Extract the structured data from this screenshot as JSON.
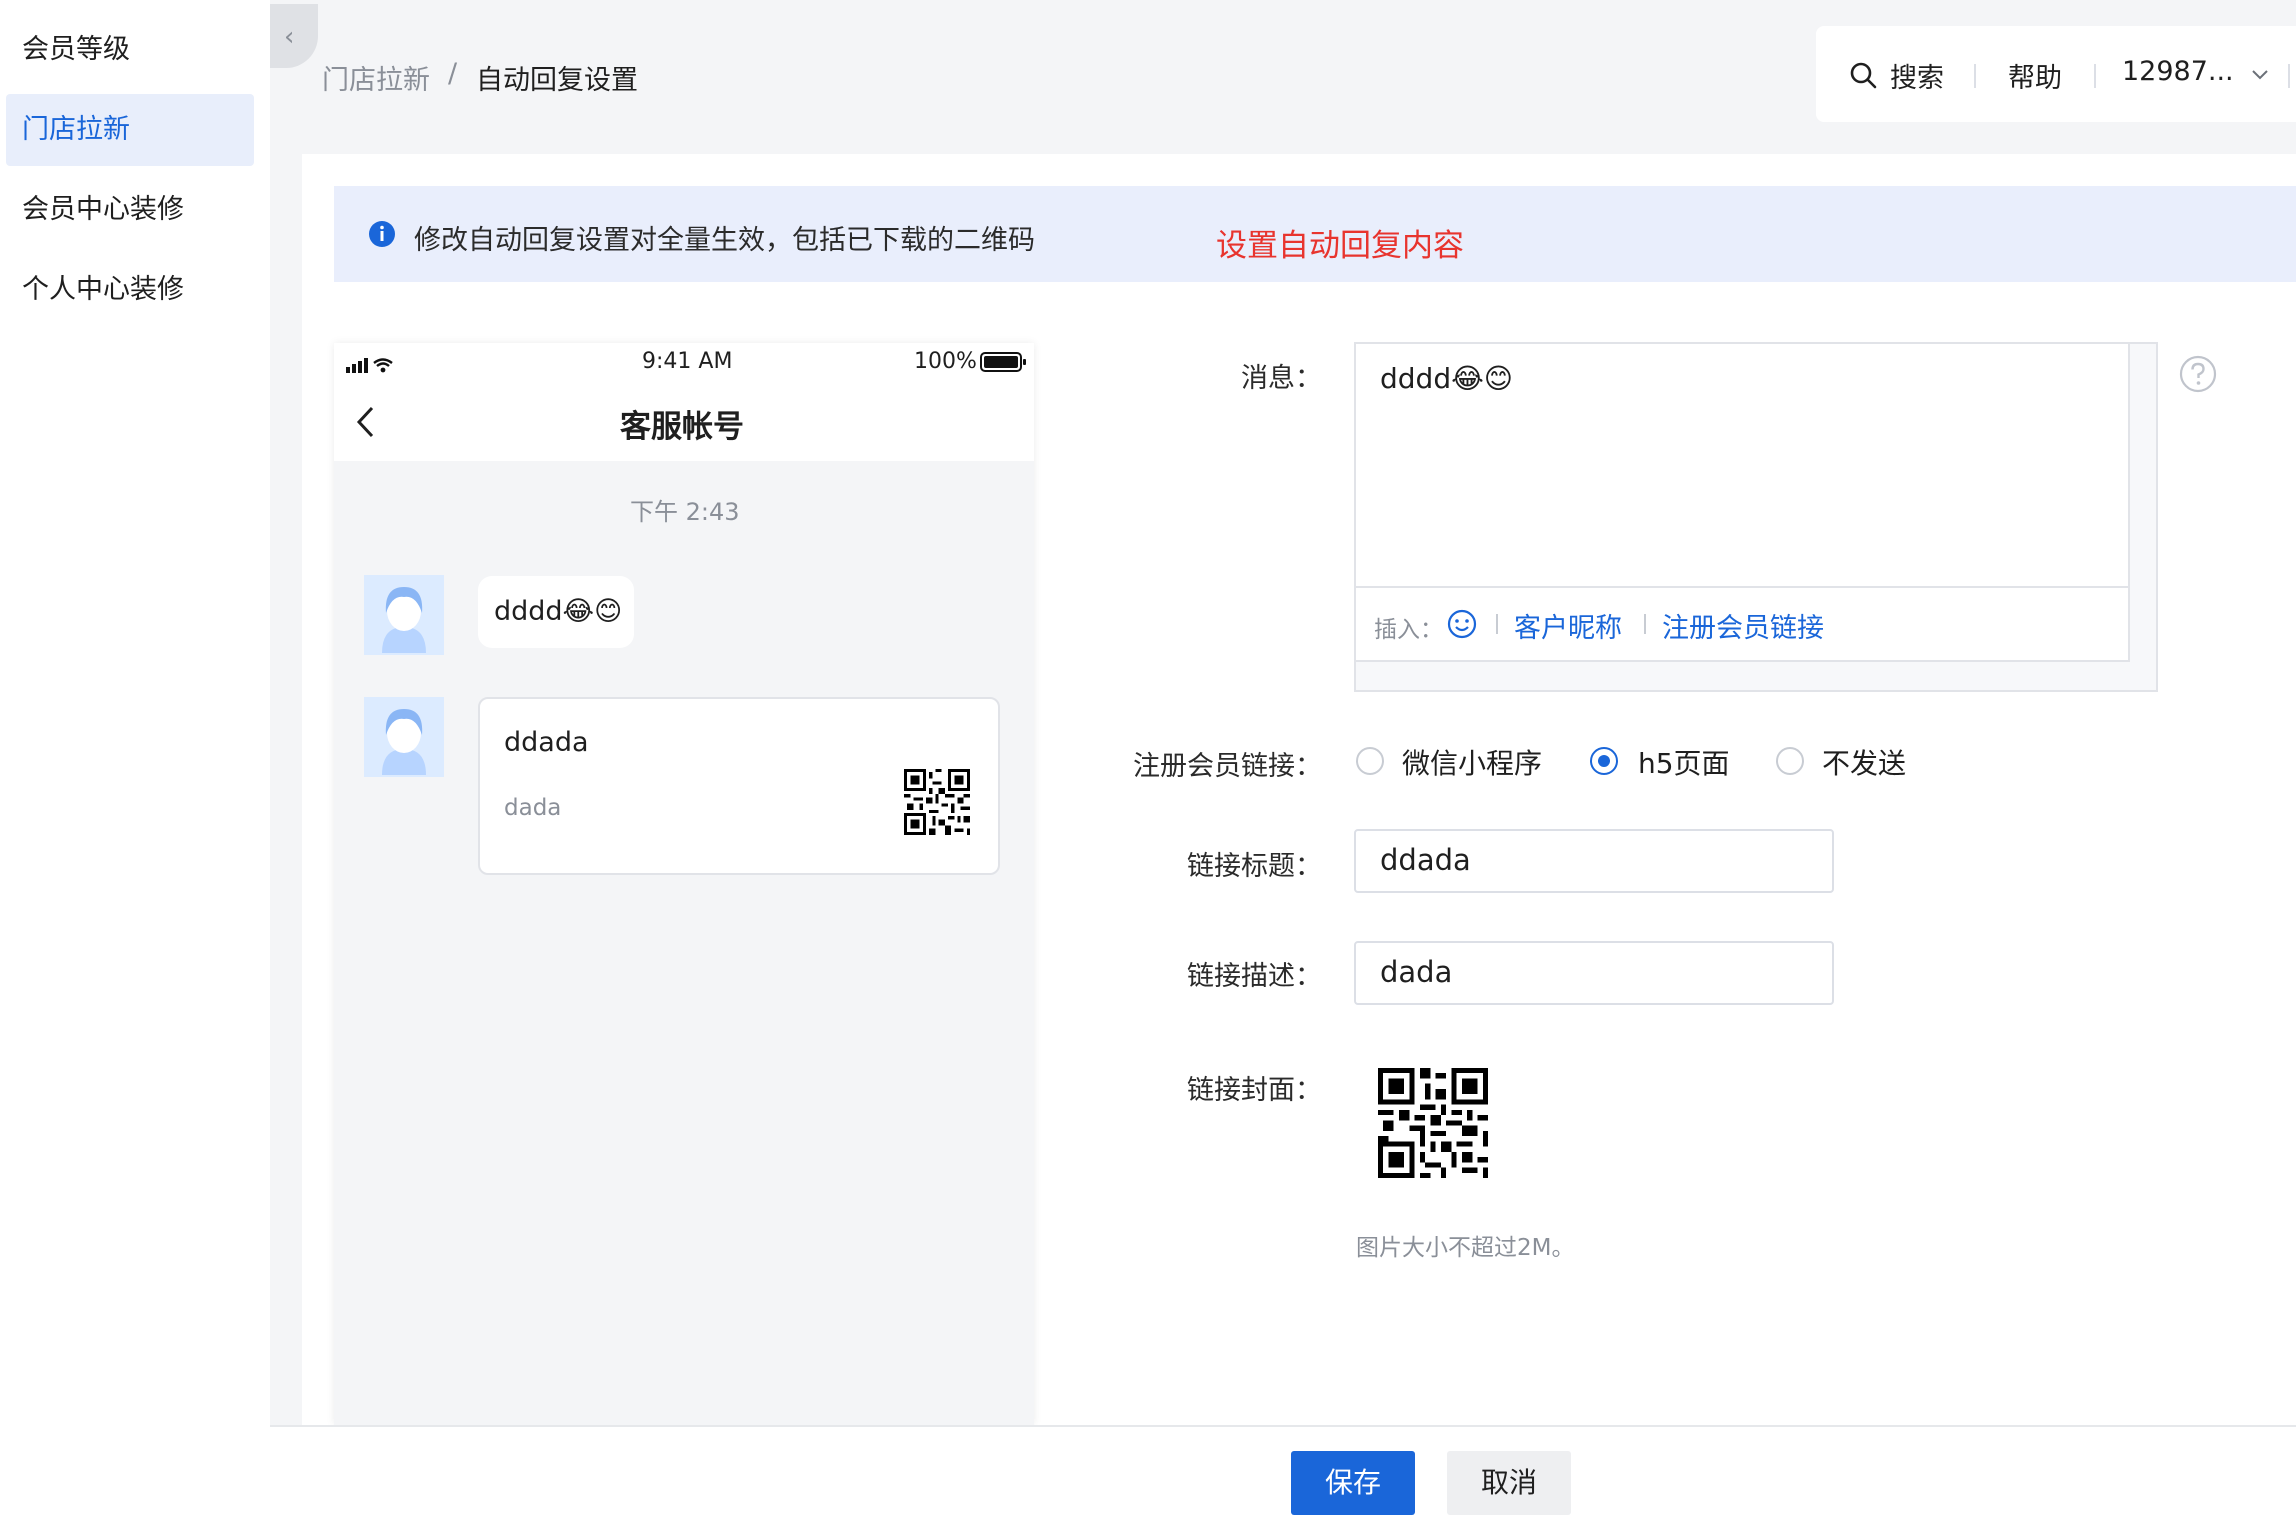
{
  "sidebar": {
    "items": [
      {
        "label": "会员等级"
      },
      {
        "label": "门店拉新"
      },
      {
        "label": "会员中心装修"
      },
      {
        "label": "个人中心装修"
      }
    ]
  },
  "breadcrumb": {
    "parent": "门店拉新",
    "separator": "/",
    "current": "自动回复设置"
  },
  "topbar": {
    "search_label": "搜索",
    "help_label": "帮助",
    "account_label": "12987..."
  },
  "notice": {
    "text": "修改自动回复设置对全量生效，包括已下载的二维码",
    "annotation": "设置自动回复内容"
  },
  "phone": {
    "time": "9:41 AM",
    "battery": "100%",
    "title": "客服帐号",
    "timestamp": "下午 2:43",
    "message_text": "dddd😂😊",
    "card_title": "ddada",
    "card_desc": "dada"
  },
  "form": {
    "message_label": "消息：",
    "message_value": "dddd😂😊",
    "insert_label": "插入：",
    "insert_nickname": "客户昵称",
    "insert_member_link": "注册会员链接",
    "register_link_label": "注册会员链接：",
    "radio_options": [
      {
        "label": "微信小程序",
        "checked": false
      },
      {
        "label": "h5页面",
        "checked": true
      },
      {
        "label": "不发送",
        "checked": false
      }
    ],
    "link_title_label": "链接标题：",
    "link_title_value": "ddada",
    "link_desc_label": "链接描述：",
    "link_desc_value": "dada",
    "link_cover_label": "链接封面：",
    "cover_hint": "图片大小不超过2M。"
  },
  "footer": {
    "save_label": "保存",
    "cancel_label": "取消"
  },
  "colors": {
    "primary": "#1a66d9",
    "annotation_red": "#e8342e",
    "notice_bg": "#e9eefc"
  }
}
